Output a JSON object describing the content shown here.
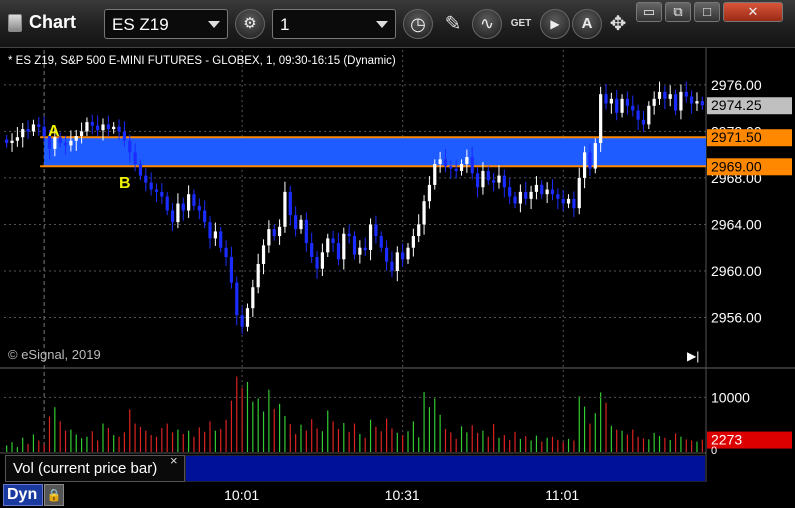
{
  "toolbar": {
    "title": "Chart",
    "symbol": "ES Z19",
    "interval": "1",
    "buttons": [
      "settings-icon",
      "clock-icon",
      "pencil-icon",
      "study-icon",
      "get-icon",
      "play-icon",
      "alert-icon",
      "pin-icon"
    ],
    "settings_glyph": "⚙",
    "clock_glyph": "◷",
    "pencil_glyph": "✎",
    "study_glyph": "∿",
    "get_glyph": "GET",
    "play_glyph": "▶",
    "alert_glyph": "A",
    "pin_glyph": "✥",
    "min_glyph": "▭",
    "restore_glyph": "⧉",
    "max_glyph": "□",
    "close_glyph": "✕"
  },
  "chart": {
    "header": "* ES Z19, S&P 500 E-MINI FUTURES - GLOBEX, 1, 09:30-16:15 (Dynamic)",
    "copyright": "© eSignal, 2019",
    "label_a": "A",
    "label_b": "B",
    "dyn_label": "Dyn",
    "lock_glyph": "🔒",
    "end_glyph": "▶|"
  },
  "volume_panel": {
    "label": "Vol (current price bar)",
    "close_glyph": "×",
    "value_label": "2273",
    "tick_label": "10000",
    "zero_label": "0"
  },
  "colors": {
    "up": "#ffffff",
    "down": "#1a2cff",
    "band": "#1e5cff",
    "band_line": "#ff8800",
    "vol_up": "#33cc33",
    "vol_down": "#dd2222",
    "last_price_bg": "#c0c0c0",
    "level_bg": "#ff8800",
    "vol_value_bg": "#dd0000"
  },
  "chart_data": {
    "type": "candlestick",
    "ylim": [
      2952,
      2979
    ],
    "yticks": [
      "2976.00",
      "2972.00",
      "2968.00",
      "2964.00",
      "2960.00",
      "2956.00"
    ],
    "last_price": "2974.25",
    "levels": [
      {
        "name": "A",
        "value": 2971.5,
        "label": "2971.50"
      },
      {
        "name": "B",
        "value": 2969.0,
        "label": "2969.00"
      }
    ],
    "xticks": [
      {
        "label": "10:01",
        "bar": 44
      },
      {
        "label": "10:31",
        "bar": 74
      },
      {
        "label": "11:01",
        "bar": 104
      }
    ],
    "volume_ylim": [
      0,
      15000
    ],
    "volume_tick": 10000,
    "volume_current": 2273,
    "closes": [
      2971.0,
      2971.2,
      2971.5,
      2972.2,
      2972.0,
      2972.6,
      2972.4,
      2971.6,
      2970.5,
      2971.5,
      2971.0,
      2970.8,
      2971.2,
      2971.6,
      2972.0,
      2972.8,
      2972.5,
      2972.1,
      2972.6,
      2972.2,
      2972.4,
      2972.0,
      2971.2,
      2970.2,
      2969.2,
      2968.2,
      2967.6,
      2967.0,
      2966.8,
      2966.4,
      2965.2,
      2964.2,
      2965.8,
      2965.2,
      2966.6,
      2965.6,
      2965.2,
      2964.2,
      2962.8,
      2963.4,
      2962.0,
      2961.2,
      2959.0,
      2956.2,
      2955.2,
      2956.8,
      2958.6,
      2960.6,
      2962.2,
      2963.6,
      2963.0,
      2963.8,
      2966.8,
      2964.8,
      2963.6,
      2964.4,
      2962.4,
      2961.2,
      2960.2,
      2961.6,
      2962.8,
      2962.4,
      2961.0,
      2963.2,
      2963.0,
      2961.4,
      2962.0,
      2961.8,
      2964.0,
      2963.0,
      2962.0,
      2960.8,
      2960.0,
      2961.6,
      2961.0,
      2962.0,
      2963.0,
      2964.0,
      2966.0,
      2967.4,
      2969.2,
      2969.6,
      2969.0,
      2968.8,
      2968.6,
      2969.2,
      2969.8,
      2968.4,
      2967.2,
      2968.6,
      2967.8,
      2967.6,
      2968.2,
      2967.2,
      2966.4,
      2965.8,
      2966.8,
      2966.2,
      2966.8,
      2967.4,
      2966.6,
      2967.0,
      2966.6,
      2966.2,
      2965.8,
      2966.2,
      2965.4,
      2968.0,
      2970.2,
      2968.8,
      2971.0,
      2975.2,
      2974.4,
      2974.8,
      2973.6,
      2974.8,
      2974.2,
      2973.8,
      2973.0,
      2972.6,
      2974.2,
      2974.8,
      2975.4,
      2974.8,
      2975.2,
      2973.8,
      2975.4,
      2975.0,
      2974.4,
      2974.6,
      2974.25
    ],
    "volumes": [
      1200,
      1800,
      900,
      2600,
      1500,
      3200,
      2100,
      1400,
      6500,
      8200,
      5600,
      3900,
      4100,
      3200,
      2500,
      2800,
      3800,
      2100,
      5200,
      4400,
      3100,
      2800,
      3600,
      7800,
      5200,
      4600,
      3900,
      3100,
      2800,
      4400,
      5200,
      3600,
      4100,
      3300,
      3900,
      2800,
      4500,
      3700,
      5600,
      3900,
      4200,
      5900,
      9400,
      13800,
      11800,
      12800,
      9200,
      9800,
      7400,
      11400,
      7900,
      8800,
      6600,
      5100,
      3300,
      5000,
      3900,
      6000,
      4300,
      3800,
      7600,
      5600,
      4200,
      5300,
      3700,
      5200,
      3300,
      2600,
      5900,
      4600,
      3800,
      6100,
      4300,
      3500,
      3100,
      3800,
      5600,
      2700,
      11000,
      8200,
      9800,
      6800,
      4200,
      3600,
      2400,
      4700,
      3600,
      4900,
      3500,
      3900,
      2800,
      5100,
      2600,
      3100,
      2200,
      3700,
      2400,
      2900,
      2100,
      3000,
      1900,
      2600,
      2800,
      2200,
      1800,
      2400,
      2100,
      10200,
      8300,
      5200,
      7100,
      10900,
      9000,
      4800,
      4100,
      3900,
      3200,
      4100,
      2800,
      2500,
      2300,
      3500,
      2900,
      2600,
      2200,
      3400,
      2800,
      2300,
      2100,
      1900,
      2273
    ]
  }
}
